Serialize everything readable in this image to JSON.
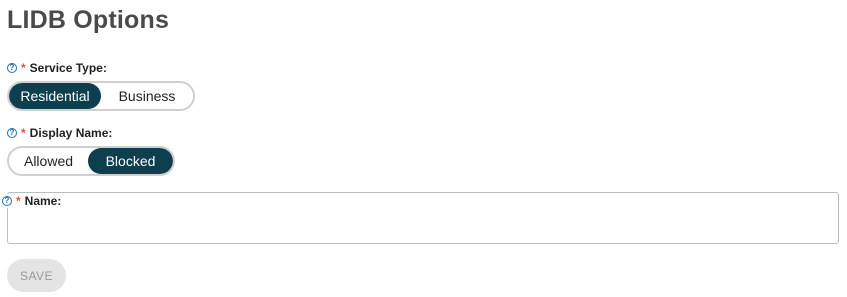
{
  "page": {
    "title": "LIDB Options"
  },
  "service_type": {
    "label": "Service Type:",
    "required_mark": "*",
    "help_glyph": "?",
    "options": [
      "Residential",
      "Business"
    ],
    "selected": "Residential"
  },
  "display_name": {
    "label": "Display Name:",
    "required_mark": "*",
    "help_glyph": "?",
    "options": [
      "Allowed",
      "Blocked"
    ],
    "selected": "Blocked"
  },
  "name_field": {
    "label": "Name:",
    "required_mark": "*",
    "help_glyph": "?",
    "value": "",
    "placeholder": ""
  },
  "actions": {
    "save_label": "SAVE"
  },
  "colors": {
    "toggle_selected_bg": "#0e3f4e",
    "help_icon": "#1e6fb8",
    "required_mark": "#d9534f",
    "save_bg_disabled": "#e4e4e4"
  }
}
